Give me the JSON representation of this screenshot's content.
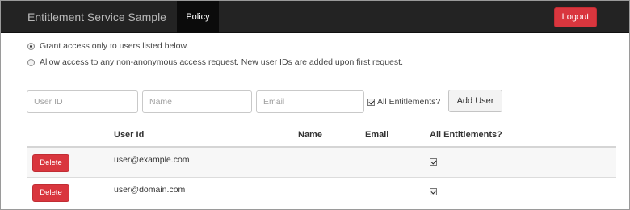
{
  "navbar": {
    "brand": "Entitlement Service Sample",
    "active_tab": "Policy",
    "logout_label": "Logout"
  },
  "access_options": [
    {
      "label": "Grant access only to users listed below.",
      "selected": true
    },
    {
      "label": "Allow access to any non-anonymous access request. New user IDs are added upon first request.",
      "selected": false
    }
  ],
  "add_form": {
    "user_id_placeholder": "User ID",
    "name_placeholder": "Name",
    "email_placeholder": "Email",
    "all_entitlements_label": "All Entitlements?",
    "all_entitlements_checked": true,
    "add_button_label": "Add User"
  },
  "table": {
    "headers": [
      "User Id",
      "Name",
      "Email",
      "All Entitlements?"
    ],
    "rows": [
      {
        "delete_label": "Delete",
        "user_id": "user@example.com",
        "name": "",
        "email": "",
        "all_entitlements": true
      },
      {
        "delete_label": "Delete",
        "user_id": "user@domain.com",
        "name": "",
        "email": "",
        "all_entitlements": true
      }
    ]
  },
  "colors": {
    "navbar_bg": "#232323",
    "danger": "#d9363e"
  }
}
